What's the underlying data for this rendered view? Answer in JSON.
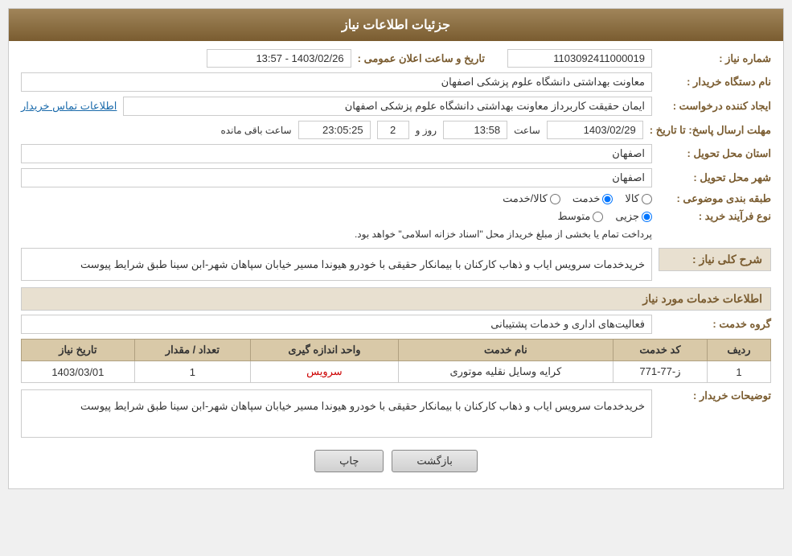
{
  "header": {
    "title": "جزئیات اطلاعات نیاز"
  },
  "fields": {
    "need_number_label": "شماره نیاز :",
    "need_number_value": "1103092411000019",
    "buyer_org_label": "نام دستگاه خریدار :",
    "buyer_org_value": "معاونت بهداشتی دانشگاه علوم پزشکی اصفهان",
    "creator_label": "ایجاد کننده درخواست :",
    "creator_value": "ایمان حقیقت کاربرداز معاونت بهداشتی دانشگاه علوم پزشکی اصفهان",
    "contact_link": "اطلاعات تماس خریدار",
    "reply_deadline_label": "مهلت ارسال پاسخ: تا تاریخ :",
    "reply_date": "1403/02/29",
    "reply_time_label": "ساعت",
    "reply_time": "13:58",
    "reply_days_label": "روز و",
    "reply_days": "2",
    "reply_countdown_label": "ساعت باقی مانده",
    "reply_countdown": "23:05:25",
    "announce_label": "تاریخ و ساعت اعلان عمومی :",
    "announce_value": "1403/02/26 - 13:57",
    "delivery_province_label": "استان محل تحویل :",
    "delivery_province_value": "اصفهان",
    "delivery_city_label": "شهر محل تحویل :",
    "delivery_city_value": "اصفهان",
    "category_label": "طبقه بندی موضوعی :",
    "category_goods": "کالا",
    "category_service": "خدمت",
    "category_goods_service": "کالا/خدمت",
    "purchase_type_label": "نوع فرآیند خرید :",
    "purchase_type_part": "جزیی",
    "purchase_type_medium": "متوسط",
    "purchase_type_note": "پرداخت تمام یا بخشی از مبلغ خریداز محل \"اسناد خزانه اسلامی\" خواهد بود.",
    "need_desc_section": "شرح کلی نیاز :",
    "need_desc_value": "خریدخدمات سرویس ایاب و ذهاب کارکنان با بیمانکار حقیقی با خودرو هیوندا مسیر خیابان سپاهان شهر-ابن سینا طبق شرایط پیوست",
    "service_info_section": "اطلاعات خدمات مورد نیاز",
    "service_group_label": "گروه خدمت :",
    "service_group_value": "فعالیت‌های اداری و خدمات پشتیبانی",
    "table": {
      "headers": [
        "ردیف",
        "کد خدمت",
        "نام خدمت",
        "واحد اندازه گیری",
        "تعداد / مقدار",
        "تاریخ نیاز"
      ],
      "rows": [
        {
          "row": "1",
          "code": "ز-77-771",
          "name": "کرایه وسایل نقلیه موتوری",
          "unit": "سرویس",
          "count": "1",
          "date": "1403/03/01"
        }
      ]
    },
    "buyer_desc_label": "توضیحات خریدار :",
    "buyer_desc_value": "خریدخدمات سرویس ایاب و ذهاب کارکنان با بیمانکار حقیقی با خودرو هیوندا مسیر خیابان سپاهان شهر-ابن سینا طبق شرایط پیوست"
  },
  "buttons": {
    "print_label": "چاپ",
    "back_label": "بازگشت"
  }
}
